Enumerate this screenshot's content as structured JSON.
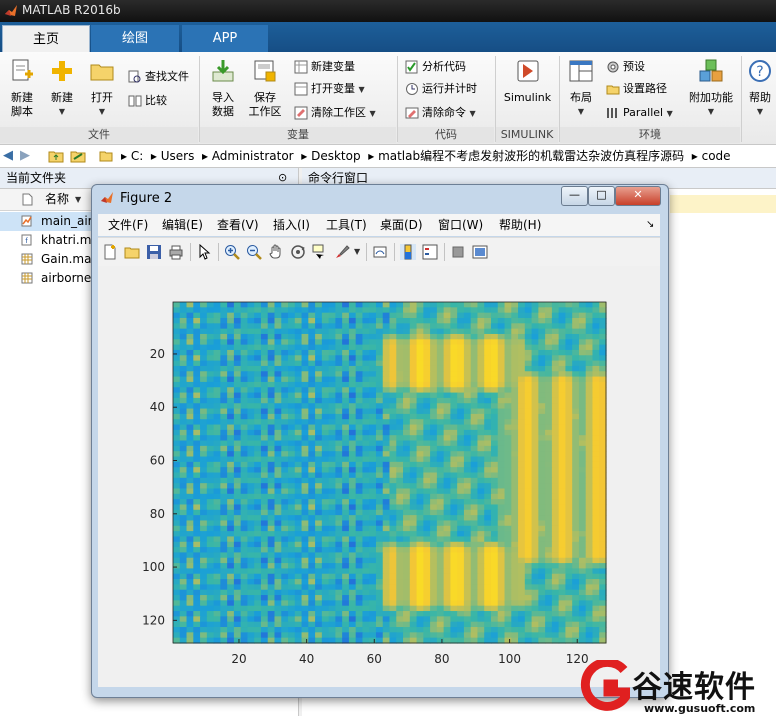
{
  "app": {
    "title": "MATLAB R2016b"
  },
  "tabs": [
    {
      "label": "主页",
      "active": true
    },
    {
      "label": "绘图",
      "active": false
    },
    {
      "label": "APP",
      "active": false
    }
  ],
  "ribbon": {
    "file": {
      "group_label": "文件",
      "new_script": "新建\n脚本",
      "new": "新建",
      "open": "打开",
      "find_files": "查找文件",
      "compare": "比较"
    },
    "variable": {
      "group_label": "变量",
      "import_data": "导入\n数据",
      "save_workspace": "保存\n工作区",
      "new_variable": "新建变量",
      "open_variable": "打开变量",
      "clear_workspace": "清除工作区"
    },
    "code": {
      "group_label": "代码",
      "analyze_code": "分析代码",
      "run_and_time": "运行并计时",
      "clear_commands": "清除命令"
    },
    "simulink": {
      "group_label": "SIMULINK",
      "simulink": "Simulink"
    },
    "environment": {
      "group_label": "环境",
      "layout": "布局",
      "preferences": "预设",
      "set_path": "设置路径",
      "parallel": "Parallel",
      "addons": "附加功能"
    },
    "resources": {
      "help": "帮助"
    }
  },
  "address": {
    "parts": [
      "C:",
      "Users",
      "Administrator",
      "Desktop",
      "matlab编程不考虑发射波形的机载雷达杂波仿真程序源码",
      "code"
    ]
  },
  "current_folder": {
    "title": "当前文件夹",
    "column_name": "名称",
    "files": [
      "main_airl",
      "khatri.m",
      "Gain.mat",
      "airborne"
    ]
  },
  "command_window": {
    "title": "命令行窗口"
  },
  "figure": {
    "title": "Figure 2",
    "menu": [
      "文件(F)",
      "编辑(E)",
      "查看(V)",
      "插入(I)",
      "工具(T)",
      "桌面(D)",
      "窗口(W)",
      "帮助(H)"
    ],
    "window_buttons": {
      "minimize": "—",
      "maximize": "□",
      "close": "✕"
    }
  },
  "chart_data": {
    "type": "heatmap",
    "title": "",
    "xlabel": "",
    "ylabel": "",
    "x_ticks": [
      20,
      40,
      60,
      80,
      100,
      120
    ],
    "y_ticks": [
      20,
      40,
      60,
      80,
      100,
      120
    ],
    "xlim": [
      0.5,
      128.5
    ],
    "ylim": [
      0.5,
      128.5
    ],
    "y_reversed": true,
    "grid_size": [
      128,
      128
    ],
    "colormap": "parula",
    "colormap_stops": [
      "#2372d9",
      "#1a9fd8",
      "#38b6a8",
      "#a3bd6a",
      "#f4c635",
      "#fbe321"
    ],
    "hot_regions": [
      {
        "x": [
          66,
          100
        ],
        "y": [
          16,
          30
        ],
        "level": 0.95
      },
      {
        "x": [
          66,
          100
        ],
        "y": [
          94,
          112
        ],
        "level": 0.95
      },
      {
        "x": [
          100,
          128
        ],
        "y": [
          30,
          95
        ],
        "level": 0.85
      }
    ]
  },
  "watermark": {
    "text": "谷速软件",
    "url": "www.gusuoft.com"
  }
}
